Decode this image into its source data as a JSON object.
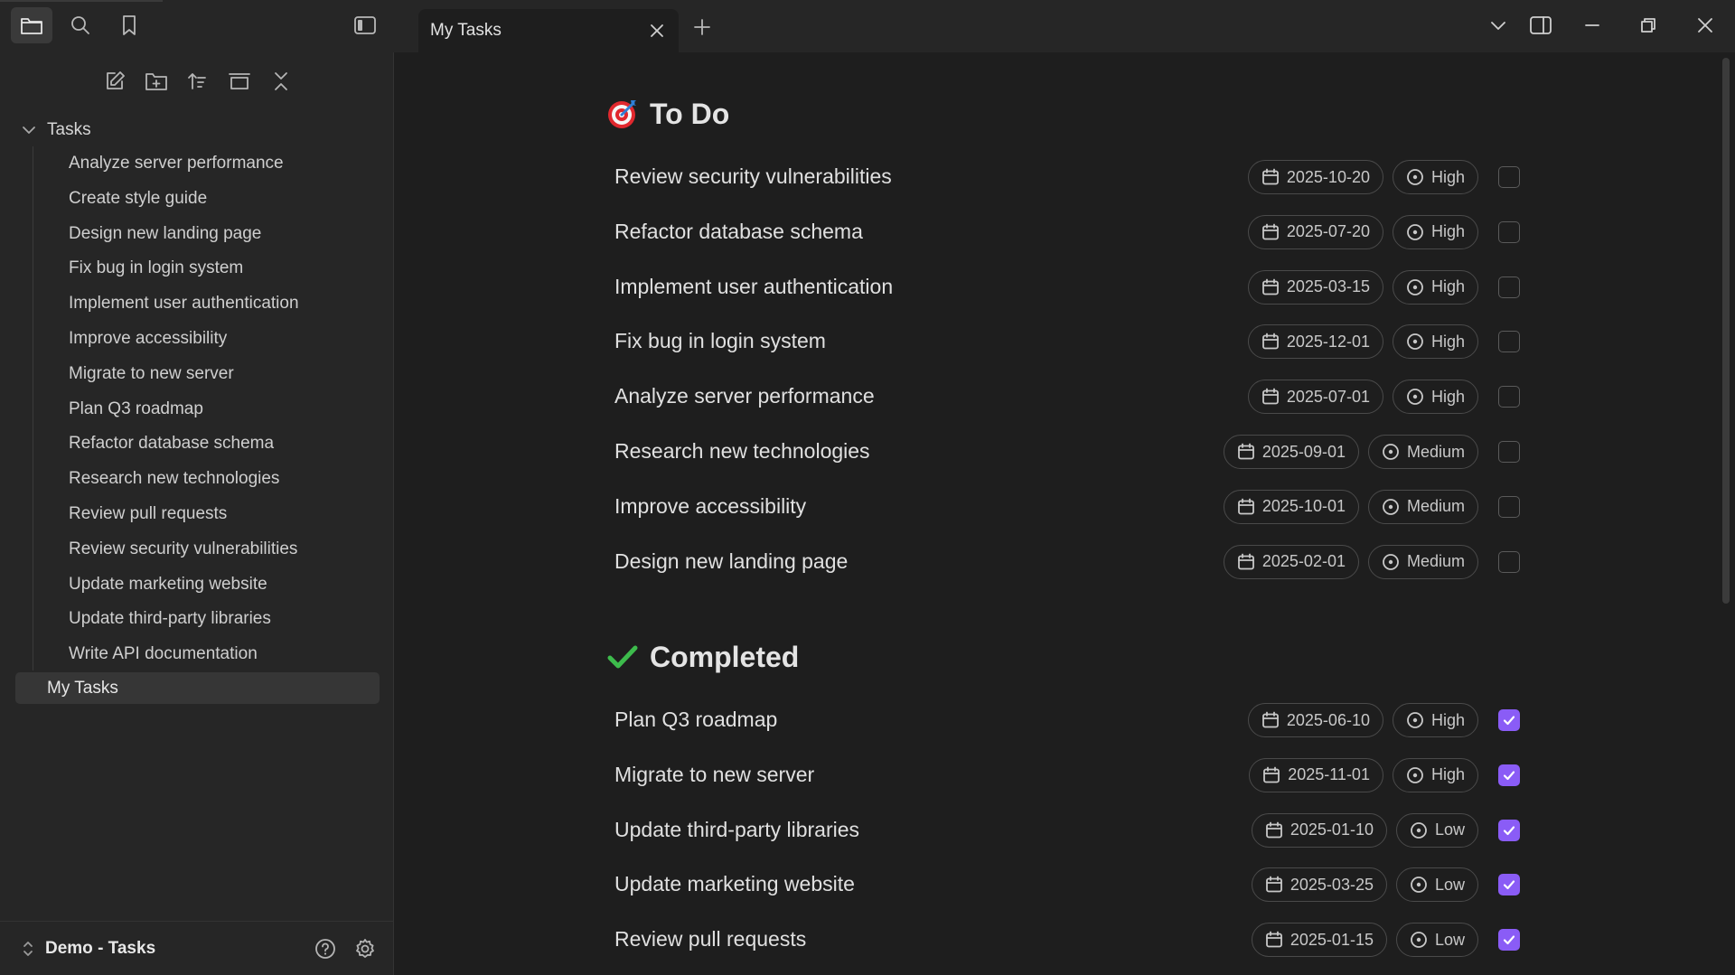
{
  "window": {
    "tab_title": "My Tasks"
  },
  "sidebar": {
    "folder": "Tasks",
    "items": [
      "Analyze server performance",
      "Create style guide",
      "Design new landing page",
      "Fix bug in login system",
      "Implement user authentication",
      "Improve accessibility",
      "Migrate to new server",
      "Plan Q3 roadmap",
      "Refactor database schema",
      "Research new technologies",
      "Review pull requests",
      "Review security vulnerabilities",
      "Update marketing website",
      "Update third-party libraries",
      "Write API documentation"
    ],
    "active_file": "My Tasks",
    "vault_name": "Demo - Tasks"
  },
  "sections": {
    "todo": {
      "title": "To Do",
      "tasks": [
        {
          "title": "Review security vulnerabilities",
          "date": "2025-10-20",
          "priority": "High",
          "done": false
        },
        {
          "title": "Refactor database schema",
          "date": "2025-07-20",
          "priority": "High",
          "done": false
        },
        {
          "title": "Implement user authentication",
          "date": "2025-03-15",
          "priority": "High",
          "done": false
        },
        {
          "title": "Fix bug in login system",
          "date": "2025-12-01",
          "priority": "High",
          "done": false
        },
        {
          "title": "Analyze server performance",
          "date": "2025-07-01",
          "priority": "High",
          "done": false
        },
        {
          "title": "Research new technologies",
          "date": "2025-09-01",
          "priority": "Medium",
          "done": false
        },
        {
          "title": "Improve accessibility",
          "date": "2025-10-01",
          "priority": "Medium",
          "done": false
        },
        {
          "title": "Design new landing page",
          "date": "2025-02-01",
          "priority": "Medium",
          "done": false
        }
      ]
    },
    "completed": {
      "title": "Completed",
      "tasks": [
        {
          "title": "Plan Q3 roadmap",
          "date": "2025-06-10",
          "priority": "High",
          "done": true
        },
        {
          "title": "Migrate to new server",
          "date": "2025-11-01",
          "priority": "High",
          "done": true
        },
        {
          "title": "Update third-party libraries",
          "date": "2025-01-10",
          "priority": "Low",
          "done": true
        },
        {
          "title": "Update marketing website",
          "date": "2025-03-25",
          "priority": "Low",
          "done": true
        },
        {
          "title": "Review pull requests",
          "date": "2025-01-15",
          "priority": "Low",
          "done": true
        }
      ]
    }
  },
  "colors": {
    "accent_checkbox": "#8a5cf6",
    "background": "#1e1e1e",
    "sidebar": "#262626"
  }
}
